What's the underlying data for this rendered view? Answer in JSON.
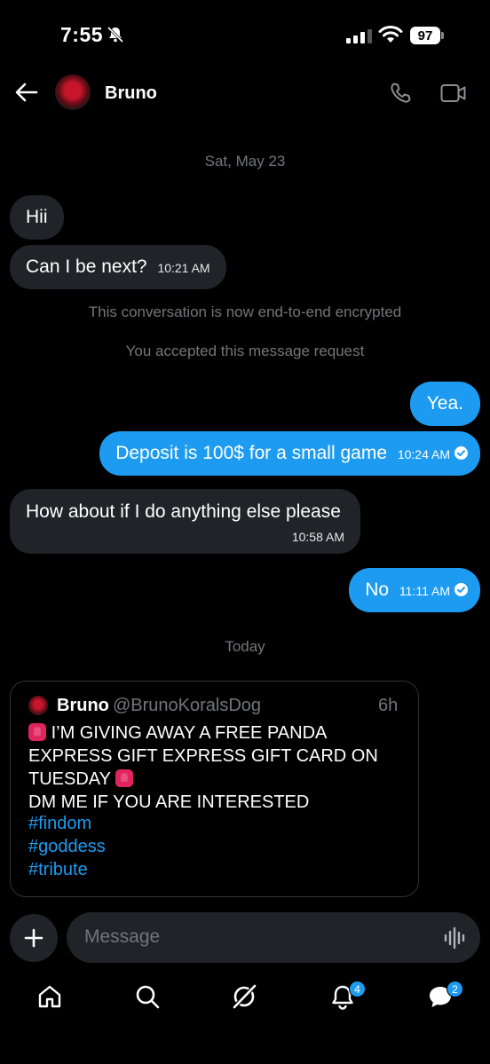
{
  "status_bar": {
    "time": "7:55",
    "battery": "97"
  },
  "header": {
    "contact_name": "Bruno"
  },
  "conversation": {
    "date_old": "Sat, May 23",
    "msg1": "Hii",
    "msg2": "Can I be next?",
    "msg2_time": "10:21 AM",
    "system1": "This conversation is now end-to-end encrypted",
    "system2": "You accepted this message request",
    "msg3": "Yea.",
    "msg4": "Deposit is 100$ for a small game",
    "msg4_time": "10:24 AM",
    "msg5": "How about if I do anything else please",
    "msg5_time": "10:58 AM",
    "msg6": "No",
    "msg6_time": "11:11 AM",
    "date_today": "Today"
  },
  "shared_post": {
    "author": "Bruno",
    "handle": "@BrunoKoralsDog",
    "time": "6h",
    "line1": "I’M GIVING AWAY A FREE PANDA",
    "line2": "EXPRESS GIFT EXPRESS GIFT CARD ON",
    "line3": "TUESDAY",
    "line4": "DM ME IF YOU ARE INTERESTED",
    "tags": [
      "#findom",
      "#goddess",
      "#tribute"
    ]
  },
  "composer": {
    "placeholder": "Message"
  },
  "nav": {
    "notifications_badge": "4",
    "messages_badge": "2"
  },
  "colors": {
    "accent": "#1d9bf0",
    "bubble_in": "#202327",
    "background": "#000000"
  }
}
